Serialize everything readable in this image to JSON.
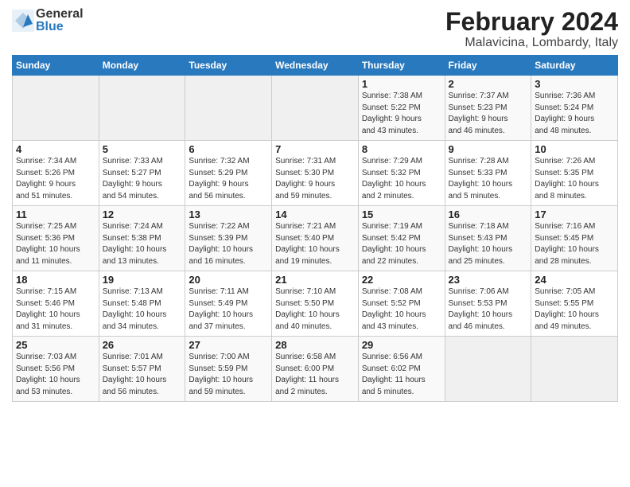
{
  "app": {
    "logo_general": "General",
    "logo_blue": "Blue",
    "month_year": "February 2024",
    "location": "Malavicina, Lombardy, Italy"
  },
  "calendar": {
    "headers": [
      "Sunday",
      "Monday",
      "Tuesday",
      "Wednesday",
      "Thursday",
      "Friday",
      "Saturday"
    ],
    "weeks": [
      [
        {
          "day": "",
          "info": ""
        },
        {
          "day": "",
          "info": ""
        },
        {
          "day": "",
          "info": ""
        },
        {
          "day": "",
          "info": ""
        },
        {
          "day": "1",
          "info": "Sunrise: 7:38 AM\nSunset: 5:22 PM\nDaylight: 9 hours\nand 43 minutes."
        },
        {
          "day": "2",
          "info": "Sunrise: 7:37 AM\nSunset: 5:23 PM\nDaylight: 9 hours\nand 46 minutes."
        },
        {
          "day": "3",
          "info": "Sunrise: 7:36 AM\nSunset: 5:24 PM\nDaylight: 9 hours\nand 48 minutes."
        }
      ],
      [
        {
          "day": "4",
          "info": "Sunrise: 7:34 AM\nSunset: 5:26 PM\nDaylight: 9 hours\nand 51 minutes."
        },
        {
          "day": "5",
          "info": "Sunrise: 7:33 AM\nSunset: 5:27 PM\nDaylight: 9 hours\nand 54 minutes."
        },
        {
          "day": "6",
          "info": "Sunrise: 7:32 AM\nSunset: 5:29 PM\nDaylight: 9 hours\nand 56 minutes."
        },
        {
          "day": "7",
          "info": "Sunrise: 7:31 AM\nSunset: 5:30 PM\nDaylight: 9 hours\nand 59 minutes."
        },
        {
          "day": "8",
          "info": "Sunrise: 7:29 AM\nSunset: 5:32 PM\nDaylight: 10 hours\nand 2 minutes."
        },
        {
          "day": "9",
          "info": "Sunrise: 7:28 AM\nSunset: 5:33 PM\nDaylight: 10 hours\nand 5 minutes."
        },
        {
          "day": "10",
          "info": "Sunrise: 7:26 AM\nSunset: 5:35 PM\nDaylight: 10 hours\nand 8 minutes."
        }
      ],
      [
        {
          "day": "11",
          "info": "Sunrise: 7:25 AM\nSunset: 5:36 PM\nDaylight: 10 hours\nand 11 minutes."
        },
        {
          "day": "12",
          "info": "Sunrise: 7:24 AM\nSunset: 5:38 PM\nDaylight: 10 hours\nand 13 minutes."
        },
        {
          "day": "13",
          "info": "Sunrise: 7:22 AM\nSunset: 5:39 PM\nDaylight: 10 hours\nand 16 minutes."
        },
        {
          "day": "14",
          "info": "Sunrise: 7:21 AM\nSunset: 5:40 PM\nDaylight: 10 hours\nand 19 minutes."
        },
        {
          "day": "15",
          "info": "Sunrise: 7:19 AM\nSunset: 5:42 PM\nDaylight: 10 hours\nand 22 minutes."
        },
        {
          "day": "16",
          "info": "Sunrise: 7:18 AM\nSunset: 5:43 PM\nDaylight: 10 hours\nand 25 minutes."
        },
        {
          "day": "17",
          "info": "Sunrise: 7:16 AM\nSunset: 5:45 PM\nDaylight: 10 hours\nand 28 minutes."
        }
      ],
      [
        {
          "day": "18",
          "info": "Sunrise: 7:15 AM\nSunset: 5:46 PM\nDaylight: 10 hours\nand 31 minutes."
        },
        {
          "day": "19",
          "info": "Sunrise: 7:13 AM\nSunset: 5:48 PM\nDaylight: 10 hours\nand 34 minutes."
        },
        {
          "day": "20",
          "info": "Sunrise: 7:11 AM\nSunset: 5:49 PM\nDaylight: 10 hours\nand 37 minutes."
        },
        {
          "day": "21",
          "info": "Sunrise: 7:10 AM\nSunset: 5:50 PM\nDaylight: 10 hours\nand 40 minutes."
        },
        {
          "day": "22",
          "info": "Sunrise: 7:08 AM\nSunset: 5:52 PM\nDaylight: 10 hours\nand 43 minutes."
        },
        {
          "day": "23",
          "info": "Sunrise: 7:06 AM\nSunset: 5:53 PM\nDaylight: 10 hours\nand 46 minutes."
        },
        {
          "day": "24",
          "info": "Sunrise: 7:05 AM\nSunset: 5:55 PM\nDaylight: 10 hours\nand 49 minutes."
        }
      ],
      [
        {
          "day": "25",
          "info": "Sunrise: 7:03 AM\nSunset: 5:56 PM\nDaylight: 10 hours\nand 53 minutes."
        },
        {
          "day": "26",
          "info": "Sunrise: 7:01 AM\nSunset: 5:57 PM\nDaylight: 10 hours\nand 56 minutes."
        },
        {
          "day": "27",
          "info": "Sunrise: 7:00 AM\nSunset: 5:59 PM\nDaylight: 10 hours\nand 59 minutes."
        },
        {
          "day": "28",
          "info": "Sunrise: 6:58 AM\nSunset: 6:00 PM\nDaylight: 11 hours\nand 2 minutes."
        },
        {
          "day": "29",
          "info": "Sunrise: 6:56 AM\nSunset: 6:02 PM\nDaylight: 11 hours\nand 5 minutes."
        },
        {
          "day": "",
          "info": ""
        },
        {
          "day": "",
          "info": ""
        }
      ]
    ]
  }
}
